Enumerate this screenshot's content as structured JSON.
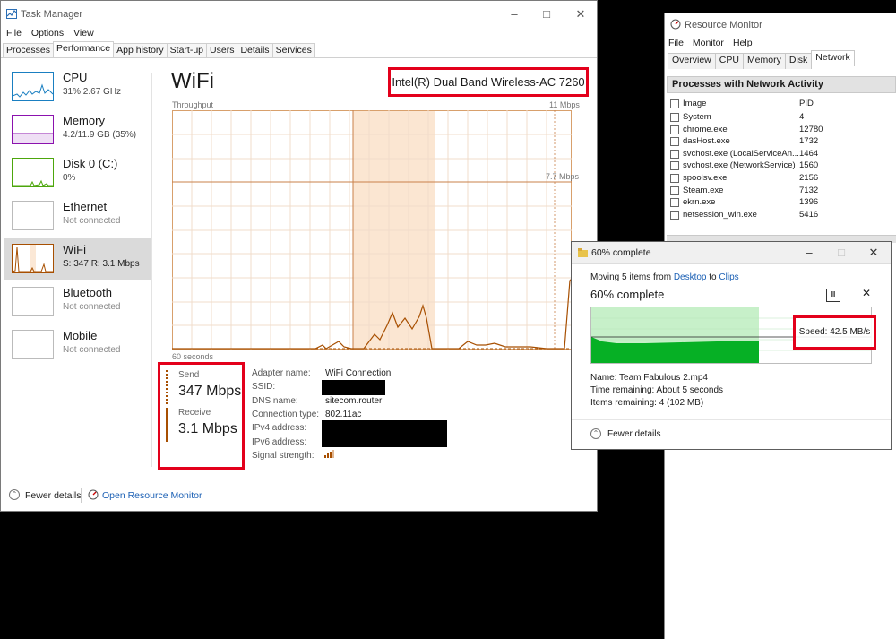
{
  "task_manager": {
    "title": "Task Manager",
    "menu": [
      "File",
      "Options",
      "View"
    ],
    "tabs": [
      "Processes",
      "Performance",
      "App history",
      "Start-up",
      "Users",
      "Details",
      "Services"
    ],
    "active_tab": "Performance",
    "sidebar": [
      {
        "name": "CPU",
        "sub": "31% 2.67 GHz",
        "color": "#1a7fc1"
      },
      {
        "name": "Memory",
        "sub": "4.2/11.9 GB (35%)",
        "color": "#8b12ae"
      },
      {
        "name": "Disk 0 (C:)",
        "sub": "0%",
        "color": "#4da60c"
      },
      {
        "name": "Ethernet",
        "sub": "Not connected",
        "color": "#a74f01"
      },
      {
        "name": "WiFi",
        "sub": "S: 347  R: 3.1 Mbps",
        "color": "#a74f01"
      },
      {
        "name": "Bluetooth",
        "sub": "Not connected",
        "color": "#a74f01"
      },
      {
        "name": "Mobile",
        "sub": "Not connected",
        "color": "#a74f01"
      }
    ],
    "main": {
      "title": "WiFi",
      "adapter_model": "Intel(R) Dual Band Wireless-AC 7260",
      "throughput_label": "Throughput",
      "max_label": "11 Mbps",
      "mid_label": "7.7 Mbps",
      "time_label": "60 seconds",
      "send_label": "Send",
      "send_value": "347 Mbps",
      "receive_label": "Receive",
      "receive_value": "3.1 Mbps",
      "details": [
        {
          "key": "Adapter name:",
          "value": "WiFi Connection"
        },
        {
          "key": "SSID:",
          "value": ""
        },
        {
          "key": "DNS name:",
          "value": "sitecom.router"
        },
        {
          "key": "Connection type:",
          "value": "802.11ac"
        },
        {
          "key": "IPv4 address:",
          "value": ""
        },
        {
          "key": "IPv6 address:",
          "value": ""
        },
        {
          "key": "Signal strength:",
          "value": ""
        }
      ]
    },
    "footer": {
      "fewer_details": "Fewer details",
      "open_resource_monitor": "Open Resource Monitor"
    },
    "accent": "#a74f01"
  },
  "resource_monitor": {
    "title": "Resource Monitor",
    "menu": [
      "File",
      "Monitor",
      "Help"
    ],
    "tabs": [
      "Overview",
      "CPU",
      "Memory",
      "Disk",
      "Network"
    ],
    "active_tab": "Network",
    "panel_title": "Processes with Network Activity",
    "columns": [
      "Image",
      "PID"
    ],
    "rows": [
      {
        "image": "System",
        "pid": "4"
      },
      {
        "image": "chrome.exe",
        "pid": "12780"
      },
      {
        "image": "dasHost.exe",
        "pid": "1732"
      },
      {
        "image": "svchost.exe (LocalServiceAn...",
        "pid": "1464"
      },
      {
        "image": "svchost.exe (NetworkService)",
        "pid": "1560"
      },
      {
        "image": "spoolsv.exe",
        "pid": "2156"
      },
      {
        "image": "Steam.exe",
        "pid": "7132"
      },
      {
        "image": "ekrn.exe",
        "pid": "1396"
      },
      {
        "image": "netsession_win.exe",
        "pid": "5416"
      }
    ]
  },
  "copy_dialog": {
    "title": "60% complete",
    "moving_prefix": "Moving 5 items from ",
    "source": "Desktop",
    "to": " to ",
    "destination": "Clips",
    "heading": "60% complete",
    "progress": 0.6,
    "speed": "Speed: 42.5 MB/s",
    "name": "Name: Team Fabulous 2.mp4",
    "time_remaining": "Time remaining: About 5 seconds",
    "items_remaining": "Items remaining: 4 (102 MB)",
    "fewer_details": "Fewer details",
    "bar_color": "#06b025"
  }
}
